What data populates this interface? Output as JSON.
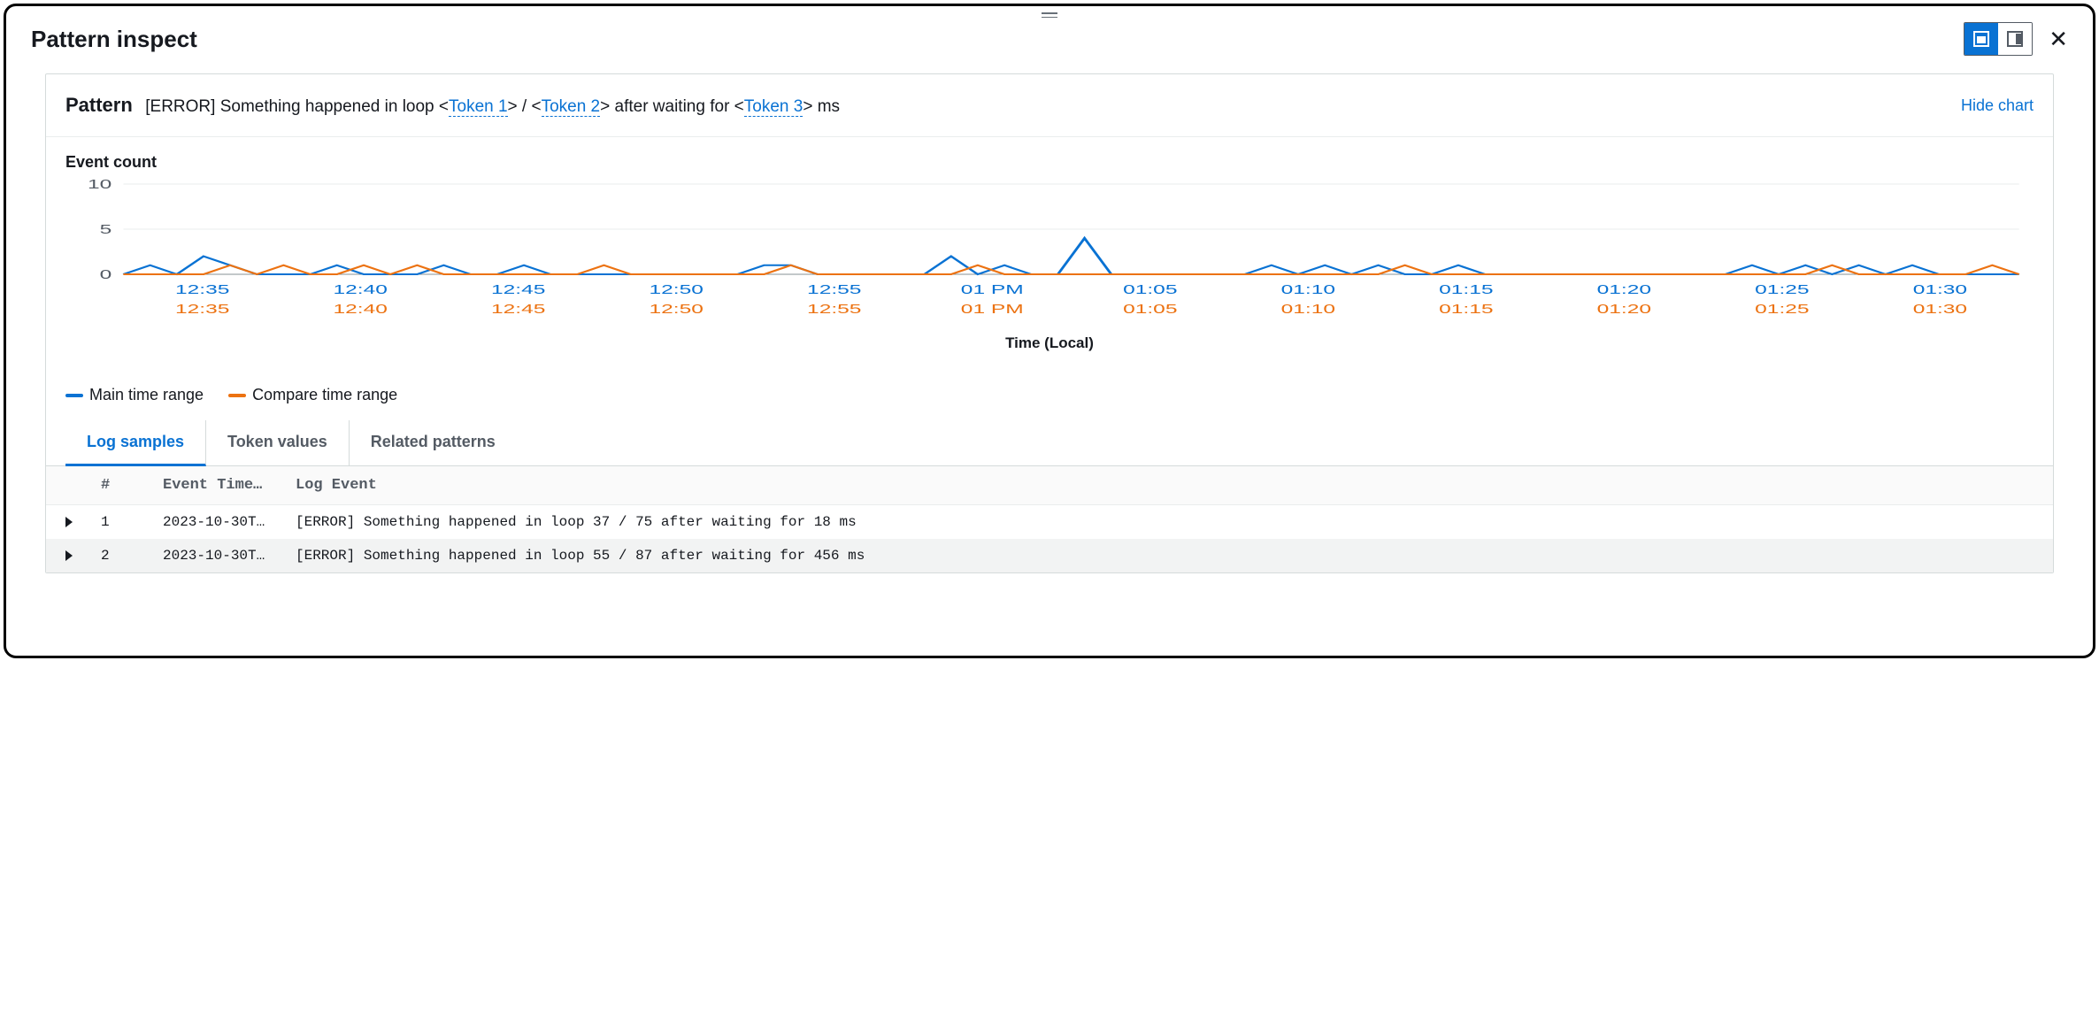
{
  "header": {
    "title": "Pattern inspect"
  },
  "panel": {
    "label": "Pattern",
    "pattern_prefix": "[ERROR] Something happened in loop <",
    "token1": "Token 1",
    "pattern_mid1": "> / <",
    "token2": "Token 2",
    "pattern_mid2": "> after waiting for <",
    "token3": "Token 3",
    "pattern_suffix": "> ms",
    "hide_chart": "Hide chart"
  },
  "chart": {
    "title": "Event count",
    "xaxis_title": "Time (Local)"
  },
  "legend": {
    "main": "Main time range",
    "compare": "Compare time range"
  },
  "tabs": {
    "log_samples": "Log samples",
    "token_values": "Token values",
    "related_patterns": "Related patterns"
  },
  "table": {
    "col_idx": "#",
    "col_time": "Event Time…",
    "col_event": "Log Event",
    "rows": [
      {
        "idx": "1",
        "time": "2023-10-30T…",
        "event": "[ERROR] Something happened in loop 37 / 75 after waiting for 18 ms"
      },
      {
        "idx": "2",
        "time": "2023-10-30T…",
        "event": "[ERROR] Something happened in loop 55 / 87 after waiting for 456 ms"
      }
    ]
  },
  "colors": {
    "main": "#0972d3",
    "compare": "#ec7211"
  },
  "chart_data": {
    "type": "line",
    "title": "Event count",
    "xlabel": "Time (Local)",
    "ylabel": "",
    "ylim": [
      0,
      10
    ],
    "categories": [
      "12:35",
      "12:40",
      "12:45",
      "12:50",
      "12:55",
      "01 PM",
      "01:05",
      "01:10",
      "01:15",
      "01:20",
      "01:25",
      "01:30"
    ],
    "series": [
      {
        "name": "Main time range",
        "color": "#0972d3",
        "values_per_tick": [
          [
            0,
            1,
            0,
            2,
            1,
            0
          ],
          [
            0,
            0,
            1,
            0,
            0,
            0
          ],
          [
            1,
            0,
            0,
            1,
            0,
            0
          ],
          [
            0,
            0,
            0,
            0,
            0,
            0
          ],
          [
            1,
            1,
            0,
            0,
            0,
            0
          ],
          [
            0,
            2,
            0,
            1,
            0,
            0
          ],
          [
            4,
            0,
            0,
            0,
            0,
            0
          ],
          [
            0,
            1,
            0,
            1,
            0,
            1
          ],
          [
            0,
            0,
            1,
            0,
            0,
            0
          ],
          [
            0,
            0,
            0,
            0,
            0,
            0
          ],
          [
            0,
            1,
            0,
            1,
            0,
            1
          ],
          [
            0,
            1,
            0,
            0,
            0,
            0
          ]
        ]
      },
      {
        "name": "Compare time range",
        "color": "#ec7211",
        "values_per_tick": [
          [
            0,
            0,
            0,
            0,
            1,
            0
          ],
          [
            1,
            0,
            0,
            1,
            0,
            1
          ],
          [
            0,
            0,
            0,
            0,
            0,
            0
          ],
          [
            1,
            0,
            0,
            0,
            0,
            0
          ],
          [
            0,
            1,
            0,
            0,
            0,
            0
          ],
          [
            0,
            0,
            1,
            0,
            0,
            0
          ],
          [
            0,
            0,
            0,
            0,
            0,
            0
          ],
          [
            0,
            0,
            0,
            0,
            0,
            0
          ],
          [
            1,
            0,
            0,
            0,
            0,
            0
          ],
          [
            0,
            0,
            0,
            0,
            0,
            0
          ],
          [
            0,
            0,
            0,
            0,
            1,
            0
          ],
          [
            0,
            0,
            0,
            0,
            1,
            0
          ]
        ]
      }
    ]
  }
}
